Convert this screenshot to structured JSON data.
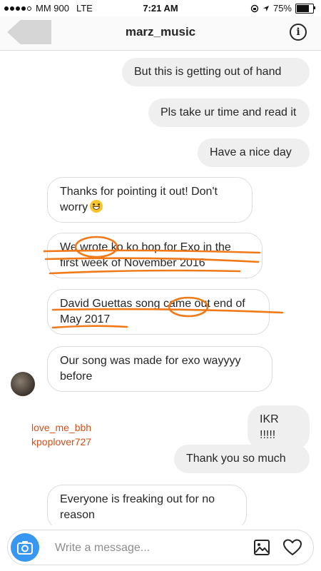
{
  "status_bar": {
    "carrier": "MM 900",
    "network": "LTE",
    "time": "7:21 AM",
    "battery": "75%",
    "battery_level": 0.75
  },
  "header": {
    "title": "marz_music",
    "back_icon": "back-arrow-icon",
    "info_icon": "info-icon",
    "info_glyph": "i"
  },
  "messages": [
    {
      "side": "out",
      "text": "But this is getting out of hand"
    },
    {
      "side": "out",
      "text": "Pls take ur time and read it"
    },
    {
      "side": "out",
      "text": "Have a nice day"
    },
    {
      "side": "in",
      "text": "Thanks for pointing it out! Don't worry"
    },
    {
      "side": "in",
      "text_line1": "We wrote ko ko bop for Exo in the",
      "text_line2": "first week of November 2016"
    },
    {
      "side": "in",
      "text_line1": "David Guettas song came out end of",
      "text_line2": "May 2017"
    },
    {
      "side": "in",
      "text": "Our song was made for exo wayyyy before"
    },
    {
      "side": "out",
      "text": "IKR !!!!!"
    },
    {
      "side": "out",
      "text": "Thank you so much"
    },
    {
      "side": "in",
      "text": "Everyone is freaking out for no reason"
    }
  ],
  "overlay_usernames": [
    "love_me_bbh",
    "kpoplover727"
  ],
  "composer": {
    "placeholder": "Write a message...",
    "camera_icon": "camera-icon",
    "gallery_icon": "gallery-icon",
    "heart_icon": "heart-icon"
  },
  "colors": {
    "accent": "#3897f0",
    "annotation": "#f07a1a",
    "username_text": "#d2501a",
    "bubble_out": "#efefef"
  }
}
